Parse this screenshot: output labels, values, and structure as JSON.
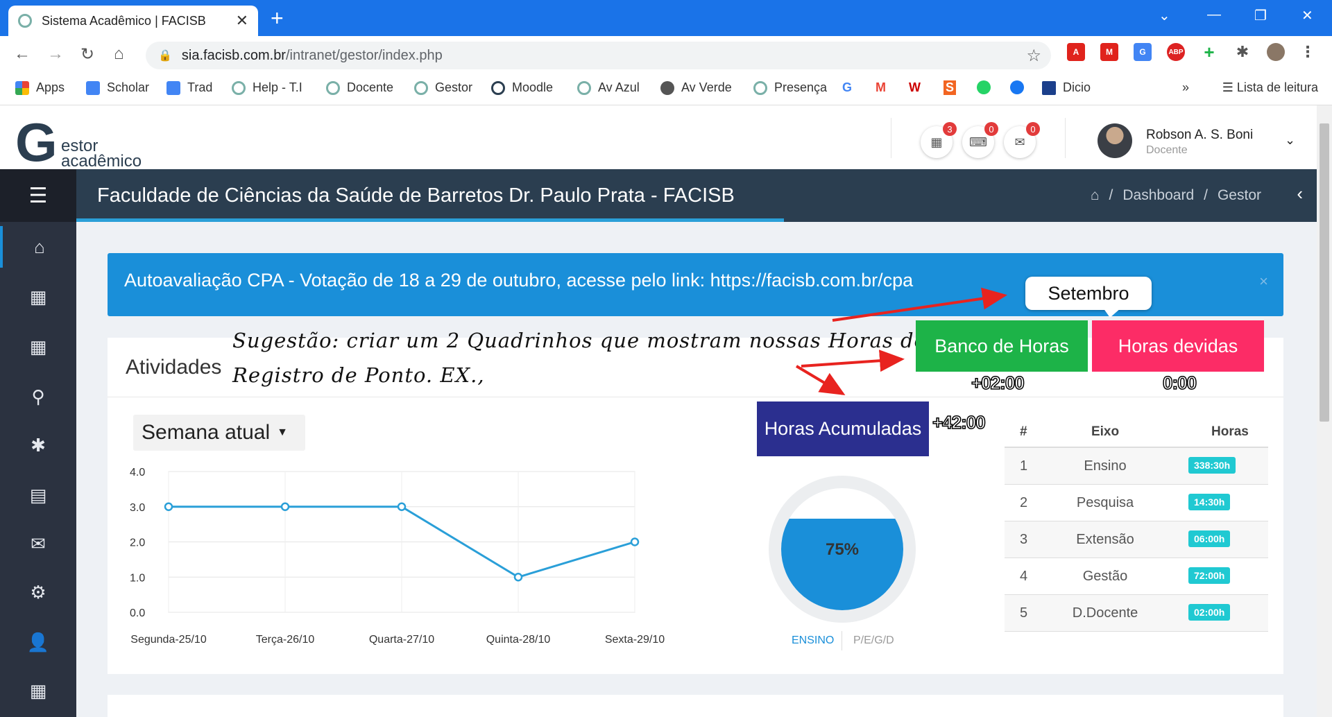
{
  "browser": {
    "tab_title": "Sistema Acadêmico | FACISB",
    "url_domain": "sia.facisb.com.br",
    "url_path": "/intranet/gestor/index.php",
    "bookmarks": [
      "Apps",
      "Scholar",
      "Trad",
      "Help - T.I",
      "Docente",
      "Gestor",
      "Moodle",
      "Av Azul",
      "Av Verde",
      "Presença",
      "Dicio"
    ],
    "reading_list": "Lista de leitura",
    "more": "»"
  },
  "app": {
    "logo_letter": "G",
    "logo_line1": "estor",
    "logo_line2": "acadêmico",
    "badges": {
      "calendar": "3",
      "keyboard": "0",
      "mail": "0"
    },
    "user_name": "Robson A. S. Boni",
    "user_role": "Docente"
  },
  "titlebar": {
    "title": "Faculdade de Ciências da Saúde de Barretos Dr. Paulo Prata - FACISB",
    "crumbs": [
      "Dashboard",
      "Gestor"
    ]
  },
  "alert": {
    "text": "Autoavaliação CPA - Votação de 18 a 29 de outubro, acesse pelo link: https://facisb.com.br/cpa",
    "close": "×"
  },
  "card": {
    "heading": "Atividades",
    "week_selector": "Semana atual"
  },
  "chart_data": {
    "type": "line",
    "categories": [
      "Segunda-25/10",
      "Terça-26/10",
      "Quarta-27/10",
      "Quinta-28/10",
      "Sexta-29/10"
    ],
    "values": [
      3.0,
      3.0,
      3.0,
      1.0,
      2.0
    ],
    "yticks": [
      "0.0",
      "1.0",
      "2.0",
      "3.0",
      "4.0"
    ],
    "ylim": [
      0,
      4
    ],
    "grid": true,
    "color": "#2a9fd8"
  },
  "gauge": {
    "value_label": "75%",
    "level": 0.75,
    "tab_active": "ENSINO",
    "tab_other": "P/E/G/D"
  },
  "table": {
    "headers": [
      "#",
      "Eixo",
      "Horas"
    ],
    "rows": [
      {
        "n": "1",
        "eixo": "Ensino",
        "horas": "338:30h"
      },
      {
        "n": "2",
        "eixo": "Pesquisa",
        "horas": "14:30h"
      },
      {
        "n": "3",
        "eixo": "Extensão",
        "horas": "06:00h"
      },
      {
        "n": "4",
        "eixo": "Gestão",
        "horas": "72:00h"
      },
      {
        "n": "5",
        "eixo": "D.Docente",
        "horas": "02:00h"
      }
    ]
  },
  "annotation": {
    "bubble": "Setembro",
    "suggest_line1": "Sugestão: criar um 2 Quadrinhos que mostram nossas Horas do",
    "suggest_line2": "Registro de Ponto. EX.,",
    "banco_label": "Banco de Horas",
    "banco_value": "+02:00",
    "devidas_label": "Horas devidas",
    "devidas_value": "0:00",
    "acum_label": "Horas Acumuladas",
    "acum_value": "+42:00",
    "colors": {
      "banco": "#1db348",
      "devidas": "#fc2c66",
      "acum": "#2b2f8f",
      "arrow": "#e8231f"
    }
  }
}
